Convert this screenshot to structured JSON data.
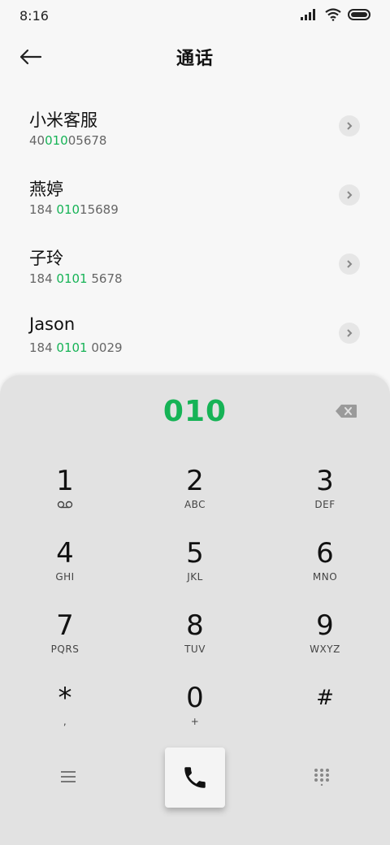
{
  "status": {
    "time": "8:16"
  },
  "app_bar": {
    "title": "通话"
  },
  "contacts": [
    {
      "name": "小米客服",
      "number_pre": "40",
      "number_hl": "010",
      "number_post": "05678"
    },
    {
      "name": "燕婷",
      "number_pre": "184 ",
      "number_hl": "010",
      "number_post": "15689"
    },
    {
      "name": "子玲",
      "number_pre": "184 ",
      "number_hl": "0101",
      "number_post": " 5678"
    },
    {
      "name": "Jason",
      "number_pre": "184 ",
      "number_hl": "0101",
      "number_post": " 0029"
    }
  ],
  "dialpad": {
    "display": "010",
    "keys": [
      {
        "digit": "1",
        "letters": ""
      },
      {
        "digit": "2",
        "letters": "ABC"
      },
      {
        "digit": "3",
        "letters": "DEF"
      },
      {
        "digit": "4",
        "letters": "GHI"
      },
      {
        "digit": "5",
        "letters": "JKL"
      },
      {
        "digit": "6",
        "letters": "MNO"
      },
      {
        "digit": "7",
        "letters": "PQRS"
      },
      {
        "digit": "8",
        "letters": "TUV"
      },
      {
        "digit": "9",
        "letters": "WXYZ"
      },
      {
        "digit": "*",
        "letters": ","
      },
      {
        "digit": "0",
        "letters": "+"
      },
      {
        "digit": "#",
        "letters": ""
      }
    ]
  },
  "icons": {
    "back": "arrow-left-icon",
    "detail": "chevron-right-icon",
    "backspace": "backspace-icon",
    "voicemail": "voicemail-icon",
    "menu": "menu-icon",
    "call": "phone-icon",
    "keypad": "dialpad-icon"
  },
  "colors": {
    "accent": "#16b356"
  }
}
